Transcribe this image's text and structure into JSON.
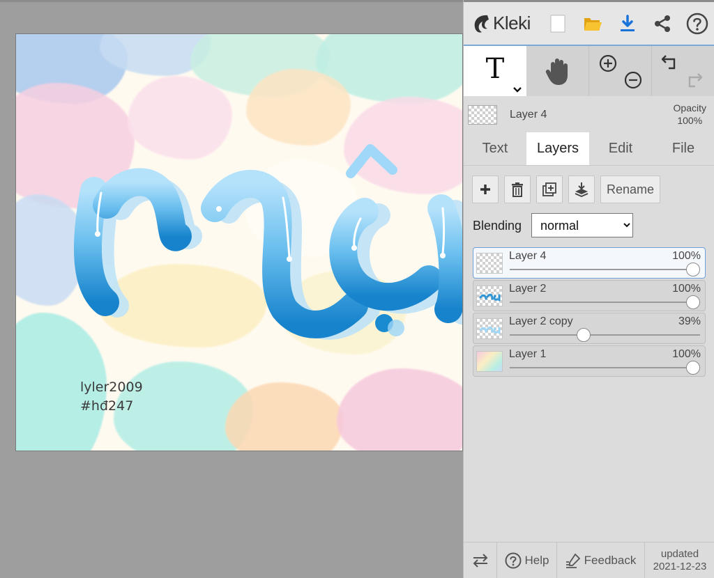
{
  "app": {
    "name": "Kleki"
  },
  "canvas": {
    "watermark_line1": "lyler2009",
    "watermark_line2": "#hđ247"
  },
  "topbar": {
    "icons": [
      "new-image-icon",
      "open-folder-icon",
      "download-icon",
      "share-icon",
      "help-circle-icon"
    ]
  },
  "current_layer": {
    "name": "Layer 4",
    "opacity_label": "Opacity",
    "opacity_value": "100%"
  },
  "tabs": [
    {
      "label": "Text",
      "active": false
    },
    {
      "label": "Layers",
      "active": true
    },
    {
      "label": "Edit",
      "active": false
    },
    {
      "label": "File",
      "active": false
    }
  ],
  "layer_actions": {
    "rename_label": "Rename"
  },
  "blending": {
    "label": "Blending",
    "selected": "normal",
    "options": [
      "normal"
    ]
  },
  "layers": [
    {
      "name": "Layer 4",
      "opacity": "100%",
      "opacity_fraction": 1.0,
      "active": true
    },
    {
      "name": "Layer 2",
      "opacity": "100%",
      "opacity_fraction": 1.0,
      "active": false
    },
    {
      "name": "Layer 2 copy",
      "opacity": "39%",
      "opacity_fraction": 0.39,
      "active": false
    },
    {
      "name": "Layer 1",
      "opacity": "100%",
      "opacity_fraction": 1.0,
      "active": false
    }
  ],
  "footer": {
    "help_label": "Help",
    "feedback_label": "Feedback",
    "updated_line1": "updated",
    "updated_line2": "2021-12-23"
  },
  "colors": {
    "accent": "#1a73d9",
    "lettering_light": "#9ed6f7",
    "lettering_dark": "#1a8bd0",
    "folder_yellow": "#f3b51c"
  }
}
